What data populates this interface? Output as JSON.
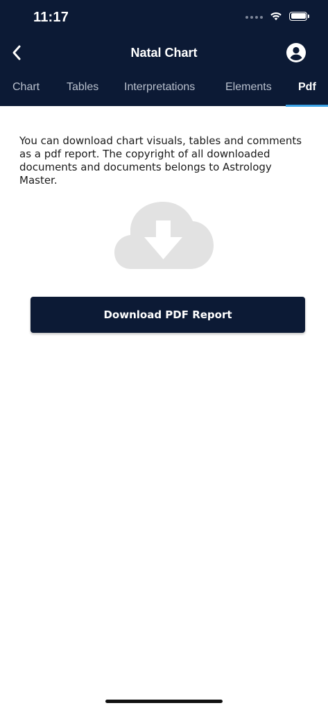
{
  "status_bar": {
    "time": "11:17",
    "icons": [
      "signal-dots-icon",
      "wifi-icon",
      "battery-icon"
    ]
  },
  "nav": {
    "title": "Natal Chart",
    "back_icon": "chevron-left-icon",
    "profile_icon": "account-circle-icon"
  },
  "tabs": [
    {
      "label": "Chart",
      "active": false
    },
    {
      "label": "Tables",
      "active": false
    },
    {
      "label": "Interpretations",
      "active": false
    },
    {
      "label": "Elements",
      "active": false
    },
    {
      "label": "Pdf",
      "active": true
    }
  ],
  "content": {
    "description": "You can download chart visuals, tables and comments as a pdf report. The copyright of all downloaded documents and documents belongs to Astrology Master.",
    "illustration_icon": "cloud-download-icon",
    "download_button_label": "Download PDF Report"
  },
  "colors": {
    "header_bg": "#0c1a35",
    "tab_indicator": "#3aa2e6",
    "illustration": "#e2e2e2",
    "button_bg": "#0c1a35"
  }
}
